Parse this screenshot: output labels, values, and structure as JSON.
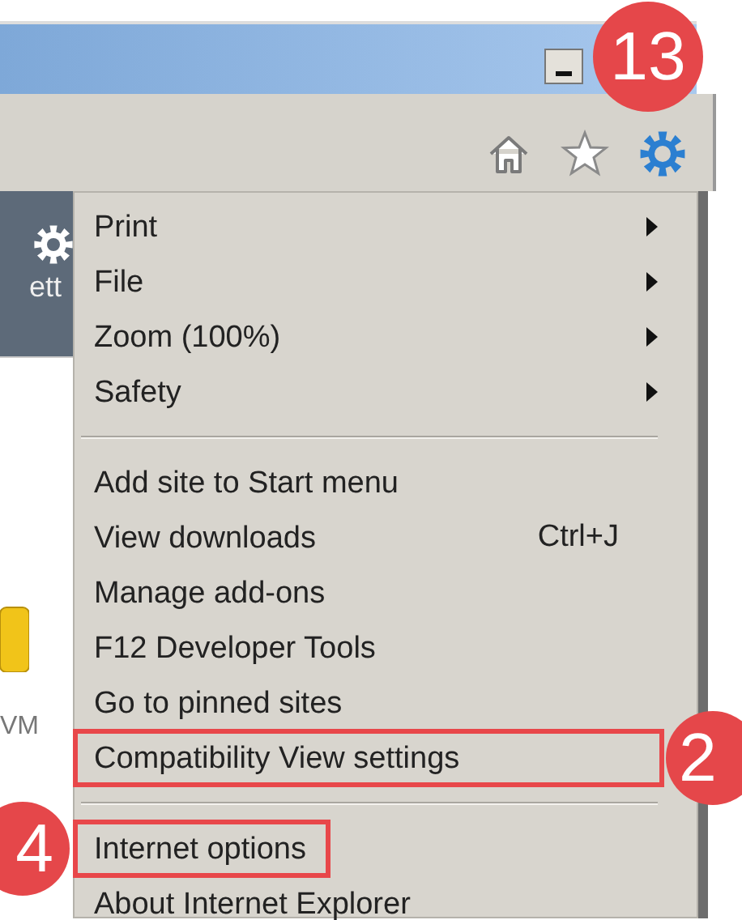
{
  "toolbar": {
    "callout": "13"
  },
  "background": {
    "panel_text": "ett",
    "icon_label": "VM"
  },
  "menu": {
    "groups": [
      [
        {
          "label": "Print",
          "submenu": true,
          "highlighted": false
        },
        {
          "label": "File",
          "submenu": true,
          "highlighted": false
        },
        {
          "label": "Zoom (100%)",
          "submenu": true,
          "highlighted": false
        },
        {
          "label": "Safety",
          "submenu": true,
          "highlighted": false
        }
      ],
      [
        {
          "label": "Add site to Start menu",
          "submenu": false,
          "highlighted": false
        },
        {
          "label": "View downloads",
          "shortcut": "Ctrl+J",
          "submenu": false,
          "highlighted": false
        },
        {
          "label": "Manage add-ons",
          "submenu": false,
          "highlighted": false
        },
        {
          "label": "F12 Developer Tools",
          "submenu": false,
          "highlighted": false
        },
        {
          "label": "Go to pinned sites",
          "submenu": false,
          "highlighted": false
        },
        {
          "label": "Compatibility View settings",
          "submenu": false,
          "highlighted": true,
          "callout": "2"
        }
      ],
      [
        {
          "label": "Internet options",
          "submenu": false,
          "highlighted": true,
          "callout": "4"
        },
        {
          "label": "About Internet Explorer",
          "submenu": false,
          "highlighted": false
        }
      ]
    ]
  }
}
